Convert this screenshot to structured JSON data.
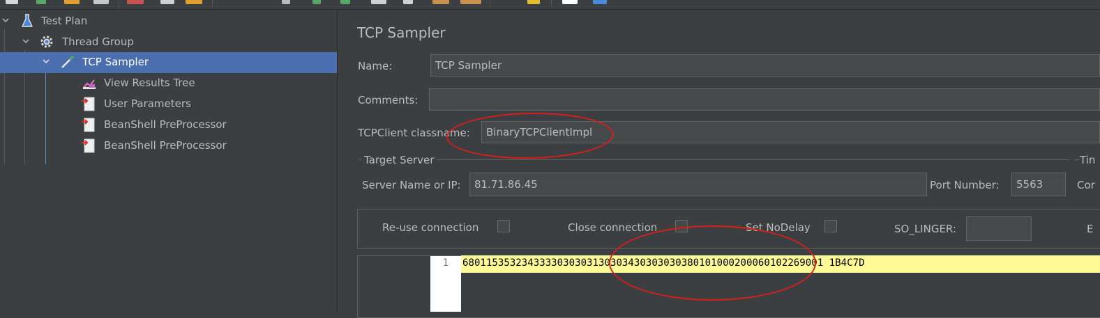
{
  "tree": {
    "items": [
      {
        "label": "Test Plan",
        "icon": "flask-icon"
      },
      {
        "label": "Thread Group",
        "icon": "gear-icon"
      },
      {
        "label": "TCP Sampler",
        "icon": "pipette-icon",
        "selected": true
      },
      {
        "label": "View Results Tree",
        "icon": "results-chart-icon"
      },
      {
        "label": "User Parameters",
        "icon": "preprocessor-icon"
      },
      {
        "label": "BeanShell PreProcessor",
        "icon": "preprocessor-icon"
      },
      {
        "label": "BeanShell PreProcessor",
        "icon": "preprocessor-icon"
      }
    ]
  },
  "sampler": {
    "title": "TCP Sampler",
    "name_label": "Name:",
    "name_value": "TCP Sampler",
    "comments_label": "Comments:",
    "comments_value": "",
    "classname_label": "TCPClient classname:",
    "classname_value": "BinaryTCPClientImpl",
    "target_server_label": "Target Server",
    "timeouts_label_partial": "Tin",
    "server_label": "Server Name or IP:",
    "server_value": "81.71.86.45",
    "port_label": "Port Number:",
    "port_value": "5563",
    "connect_partial": "Cor",
    "reuse_label": "Re-use connection",
    "close_label": "Close connection",
    "nodelay_label": "Set NoDelay",
    "solinger_label": "SO_LINGER:",
    "solinger_value": "",
    "eol_partial": "E",
    "request_line_number": "1",
    "request_data": "6801153532343333030303130303430303030380101000200060102269001 1B4C7D"
  },
  "colors": {
    "background": "#3c3f41",
    "selection": "#4b6eaf",
    "annotation": "#d91e18",
    "code_highlight": "#fefa97"
  }
}
